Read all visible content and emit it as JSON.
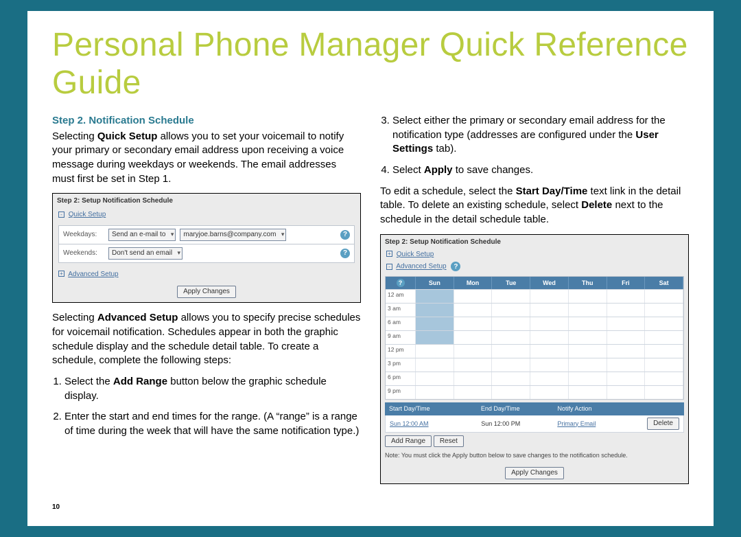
{
  "title": "Personal Phone Manager Quick Reference Guide",
  "page_number": "10",
  "left": {
    "step_heading": "Step 2. Notification Schedule",
    "intro_pre": "Selecting ",
    "intro_bold": "Quick Setup",
    "intro_post": " allows you to set your voicemail to notify your primary or secondary email address upon receiving a voice message during weekdays or weekends. The email addresses must first be set in Step 1.",
    "panel1": {
      "title": "Step 2: Setup Notification Schedule",
      "quick_link": "Quick Setup",
      "weekdays_label": "Weekdays:",
      "weekdays_action": "Send an e-mail to",
      "weekdays_email": "maryjoe.barns@company.com",
      "weekends_label": "Weekends:",
      "weekends_action": "Don't send an email",
      "advanced_link": "Advanced Setup",
      "apply": "Apply Changes"
    },
    "advanced_pre": "Selecting ",
    "advanced_bold": "Advanced Setup",
    "advanced_post": " allows you to specify precise schedules for voicemail notification. Schedules appear in both the graphic schedule display and the schedule detail table. To create a schedule, complete the following steps:",
    "li1_pre": "Select the ",
    "li1_bold": "Add Range",
    "li1_post": " button below the graphic schedule display.",
    "li2": "Enter the start and end times for the range. (A “range” is a range of time during the week that will have the same notification type.)"
  },
  "right": {
    "li3_pre": "Select either the primary or secondary email address for the notification type (addresses are configured under the ",
    "li3_bold": "User Settings",
    "li3_post": " tab).",
    "li4_pre": "Select ",
    "li4_bold": "Apply",
    "li4_post": " to save changes.",
    "edit_pre": "To edit a schedule, select the ",
    "edit_bold1": "Start Day/Time",
    "edit_mid": " text link in the detail table. To delete an existing schedule, select ",
    "edit_bold2": "Delete",
    "edit_post": " next to the schedule in the detail schedule table.",
    "panel2": {
      "title": "Step 2: Setup Notification Schedule",
      "quick_link": "Quick Setup",
      "advanced_link": "Advanced Setup",
      "days": [
        "Sun",
        "Mon",
        "Tue",
        "Wed",
        "Thu",
        "Fri",
        "Sat"
      ],
      "times": [
        "12 am",
        "3 am",
        "6 am",
        "9 am",
        "12 pm",
        "3 pm",
        "6 pm",
        "9 pm"
      ],
      "detail_headers": [
        "Start Day/Time",
        "End Day/Time",
        "Notify Action",
        ""
      ],
      "detail_start": "Sun 12:00 AM",
      "detail_end": "Sun 12:00 PM",
      "detail_action": "Primary Email",
      "delete": "Delete",
      "add_range": "Add Range",
      "reset": "Reset",
      "note": "Note: You must click the Apply button below to save changes to the notification schedule.",
      "apply": "Apply Changes"
    }
  }
}
